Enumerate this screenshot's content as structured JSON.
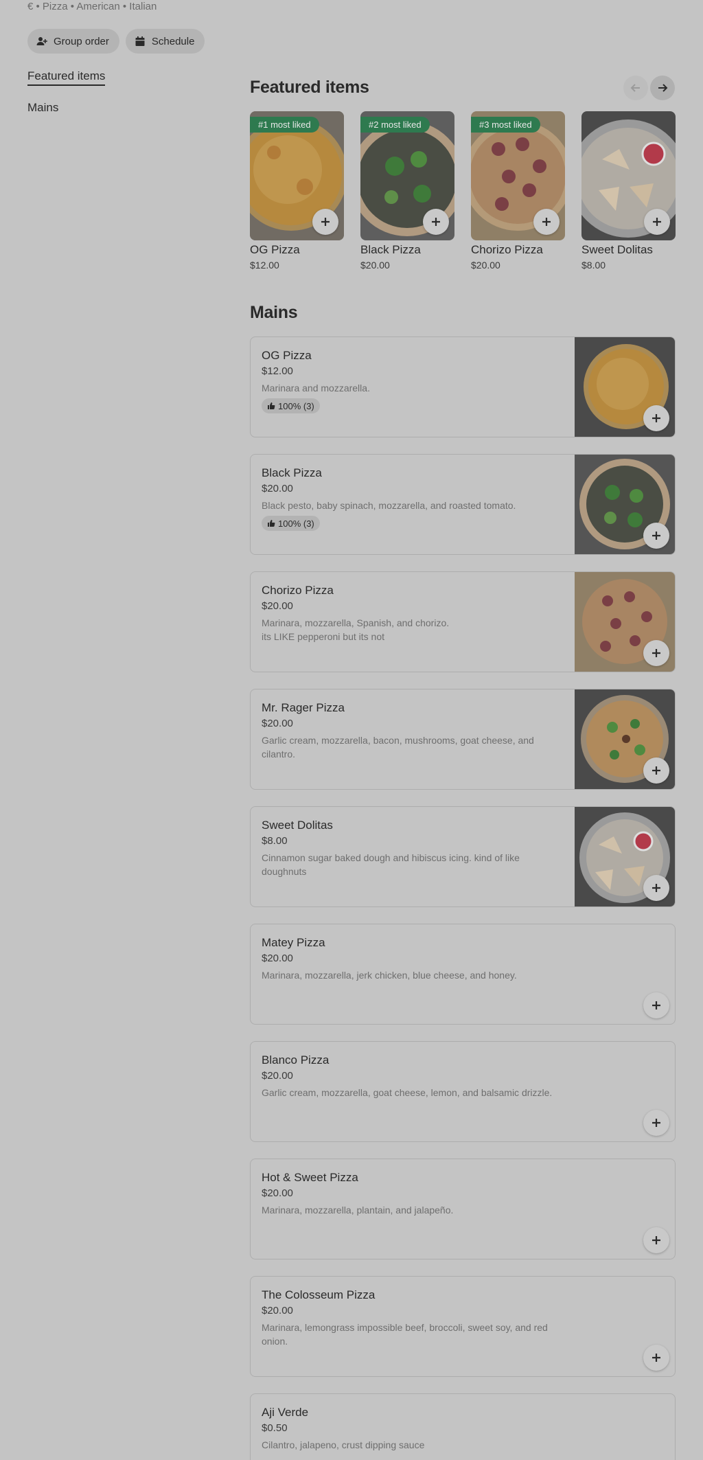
{
  "meta": {
    "line": "€ • Pizza • American • Italian"
  },
  "chips": {
    "group_order": "Group order",
    "schedule": "Schedule"
  },
  "sidebar": {
    "items": [
      {
        "label": "Featured items"
      },
      {
        "label": "Mains"
      }
    ]
  },
  "featured": {
    "title": "Featured items",
    "items": [
      {
        "name": "OG Pizza",
        "price": "$12.00",
        "badge": "#1 most liked",
        "image": "og-pizza"
      },
      {
        "name": "Black Pizza",
        "price": "$20.00",
        "badge": "#2 most liked",
        "image": "black-pizza"
      },
      {
        "name": "Chorizo Pizza",
        "price": "$20.00",
        "badge": "#3 most liked",
        "image": "chorizo-pizza"
      },
      {
        "name": "Sweet Dolitas",
        "price": "$8.00",
        "badge": "",
        "image": "sweet-dolitas"
      }
    ]
  },
  "mains": {
    "title": "Mains",
    "items": [
      {
        "name": "OG Pizza",
        "price": "$12.00",
        "desc": "Marinara and mozzarella.",
        "rating": "100% (3)",
        "image": "og-pizza"
      },
      {
        "name": "Black Pizza",
        "price": "$20.00",
        "desc": "Black pesto, baby spinach, mozzarella, and roasted tomato.",
        "rating": "100% (3)",
        "image": "black-pizza"
      },
      {
        "name": "Chorizo Pizza",
        "price": "$20.00",
        "desc": "Marinara, mozzarella, Spanish, and chorizo.\nits LIKE pepperoni but its not",
        "rating": "",
        "image": "chorizo-pizza"
      },
      {
        "name": "Mr. Rager Pizza",
        "price": "$20.00",
        "desc": "Garlic cream, mozzarella, bacon, mushrooms, goat cheese, and cilantro.",
        "rating": "",
        "image": "rager-pizza"
      },
      {
        "name": "Sweet Dolitas",
        "price": "$8.00",
        "desc": "Cinnamon sugar baked dough and hibiscus icing. kind of like doughnuts",
        "rating": "",
        "image": "sweet-dolitas"
      },
      {
        "name": "Matey Pizza",
        "price": "$20.00",
        "desc": "Marinara, mozzarella, jerk chicken, blue cheese, and honey.",
        "rating": "",
        "image": ""
      },
      {
        "name": "Blanco Pizza",
        "price": "$20.00",
        "desc": "Garlic cream, mozzarella, goat cheese, lemon, and balsamic drizzle.",
        "rating": "",
        "image": ""
      },
      {
        "name": "Hot & Sweet Pizza",
        "price": "$20.00",
        "desc": "Marinara, mozzarella, plantain, and jalapeño.",
        "rating": "",
        "image": ""
      },
      {
        "name": "The Colosseum Pizza",
        "price": "$20.00",
        "desc": "Marinara, lemongrass impossible beef, broccoli, sweet soy, and red onion.",
        "rating": "",
        "image": ""
      },
      {
        "name": "Aji Verde",
        "price": "$0.50",
        "desc": "Cilantro, jalapeno, crust dipping sauce",
        "rating": "",
        "image": ""
      }
    ]
  },
  "colors": {
    "badge": "#2e7a4f",
    "overlay_bg": "#c4c4c4"
  }
}
